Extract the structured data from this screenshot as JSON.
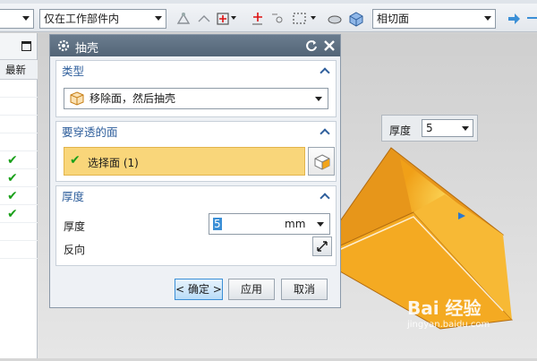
{
  "toolbar": {
    "filter_combo": "",
    "scope_combo": "仅在工作部件内",
    "rule_combo": "相切面"
  },
  "nav": {
    "column_header": "最新",
    "checks": [
      "✔",
      "✔",
      "✔",
      "✔"
    ]
  },
  "dialog": {
    "title": "抽壳",
    "type_group": {
      "label": "类型",
      "value": "移除面，然后抽壳"
    },
    "face_group": {
      "label": "要穿透的面",
      "select_label": "选择面 (1)"
    },
    "thickness_group": {
      "label": "厚度",
      "thickness_label": "厚度",
      "thickness_value": "5",
      "unit": "mm",
      "reverse_label": "反向"
    },
    "buttons": {
      "ok": "< 确定 >",
      "apply": "应用",
      "cancel": "取消"
    }
  },
  "floating_input": {
    "label": "厚度",
    "value": "5"
  },
  "watermark": {
    "text": "Bai 经验",
    "sub": "jingyan.baidu.com"
  },
  "colors": {
    "accent": "#2f5f9c",
    "selection": "#f9d67a",
    "titlebar": "#5d6f82",
    "model": "#f2a41a"
  }
}
